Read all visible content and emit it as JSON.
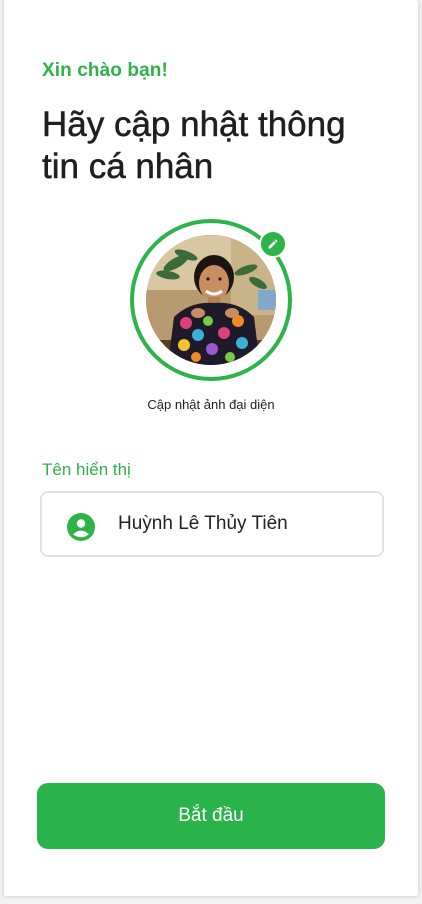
{
  "header": {
    "greeting": "Xin chào bạn!",
    "title": "Hãy cập nhật thông tin cá nhân"
  },
  "avatar": {
    "caption": "Cập nhật ảnh đại diện",
    "edit_icon": "pencil-icon"
  },
  "display_name": {
    "label": "Tên hiển thị",
    "value": "Huỳnh Lê Thủy Tiên",
    "icon": "account-circle-icon"
  },
  "actions": {
    "start_label": "Bắt đầu"
  },
  "colors": {
    "accent": "#2db34a",
    "title_text": "#1f1f1f",
    "field_border": "#e2e2e2"
  }
}
